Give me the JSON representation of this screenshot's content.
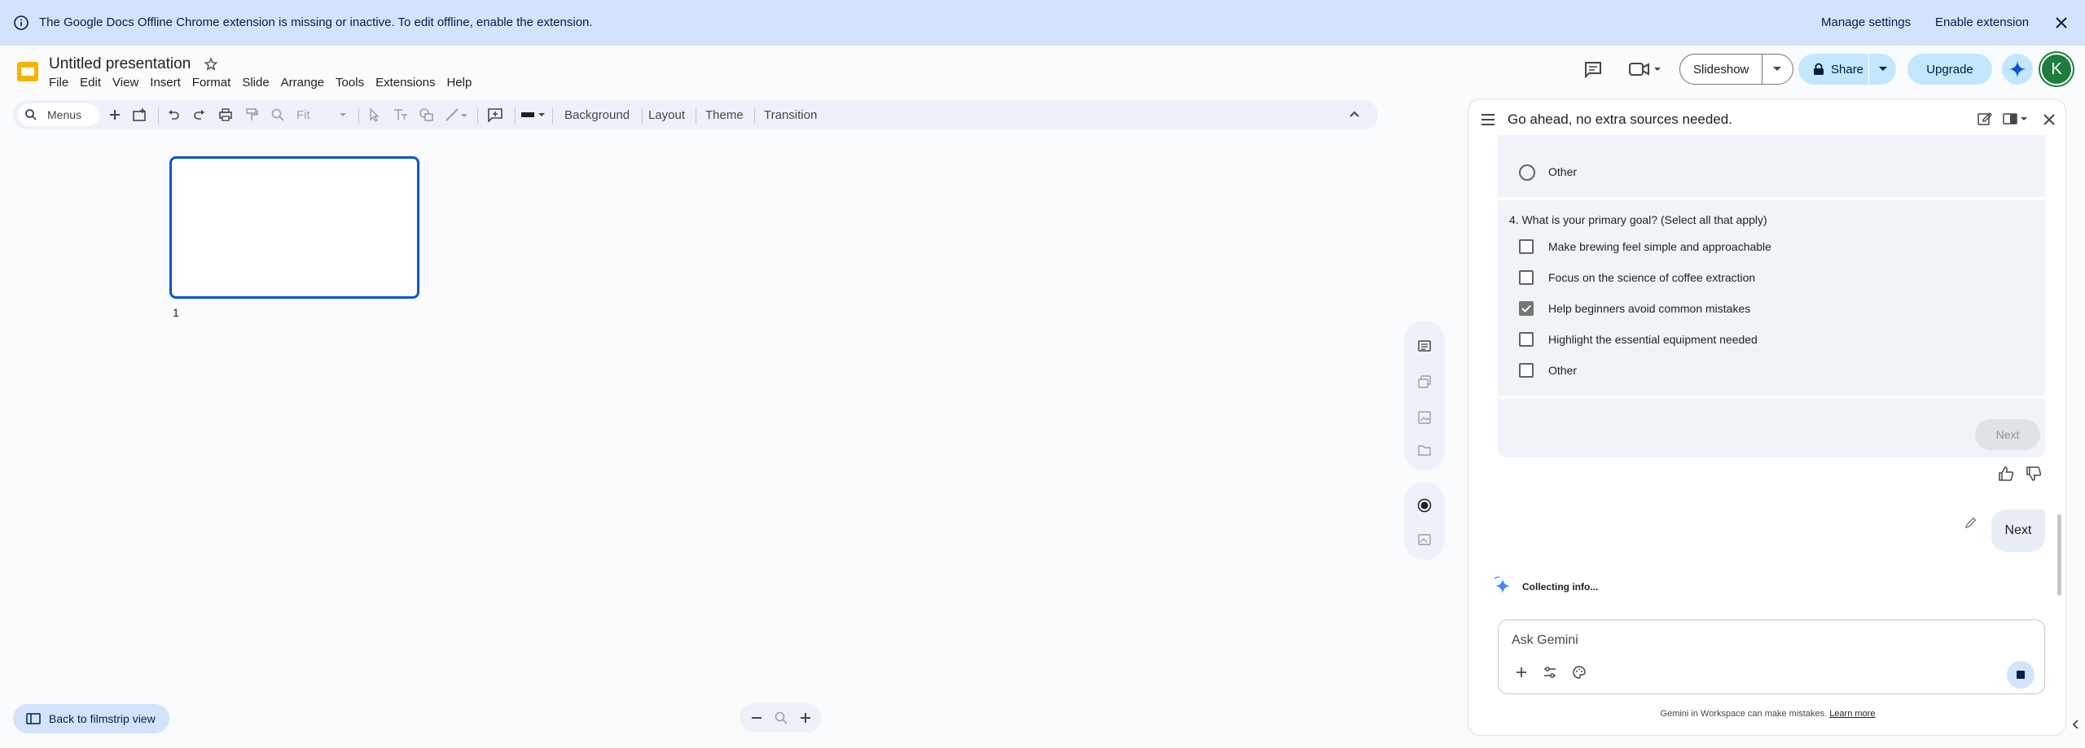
{
  "banner": {
    "message": "The Google Docs Offline Chrome extension is missing or inactive. To edit offline, enable the extension.",
    "manage_settings": "Manage settings",
    "enable_extension": "Enable extension",
    "icon": "info-icon"
  },
  "doc": {
    "title": "Untitled presentation",
    "menus": [
      "File",
      "Edit",
      "View",
      "Insert",
      "Format",
      "Slide",
      "Arrange",
      "Tools",
      "Extensions",
      "Help"
    ]
  },
  "header": {
    "slideshow": "Slideshow",
    "share": "Share",
    "upgrade": "Upgrade",
    "avatar_letter": "K"
  },
  "toolbar": {
    "search_label": "Menus",
    "zoom": "Fit",
    "background": "Background",
    "layout": "Layout",
    "theme": "Theme",
    "transition": "Transition"
  },
  "filmstrip": {
    "slide_number": "1",
    "back_label": "Back to filmstrip view"
  },
  "gemini": {
    "title": "Go ahead, no extra sources needed.",
    "prev_option": "Other",
    "question": "4. What is your primary goal? (Select all that apply)",
    "options": [
      {
        "label": "Make brewing feel simple and approachable",
        "checked": false
      },
      {
        "label": "Focus on the science of coffee extraction",
        "checked": false
      },
      {
        "label": "Help beginners avoid common mistakes",
        "checked": true
      },
      {
        "label": "Highlight the essential equipment needed",
        "checked": false
      },
      {
        "label": "Other",
        "checked": false
      }
    ],
    "next_button": "Next",
    "user_message": "Next",
    "status": "Collecting info...",
    "input_placeholder": "Ask Gemini",
    "disclaimer": "Gemini in Workspace can make mistakes.",
    "learn_more": "Learn more"
  },
  "colors": {
    "banner_bg": "#d3e3fd",
    "accent": "#0b57d0",
    "share_bg": "#c2e7ff",
    "avatar_bg": "#1e7d3e"
  }
}
